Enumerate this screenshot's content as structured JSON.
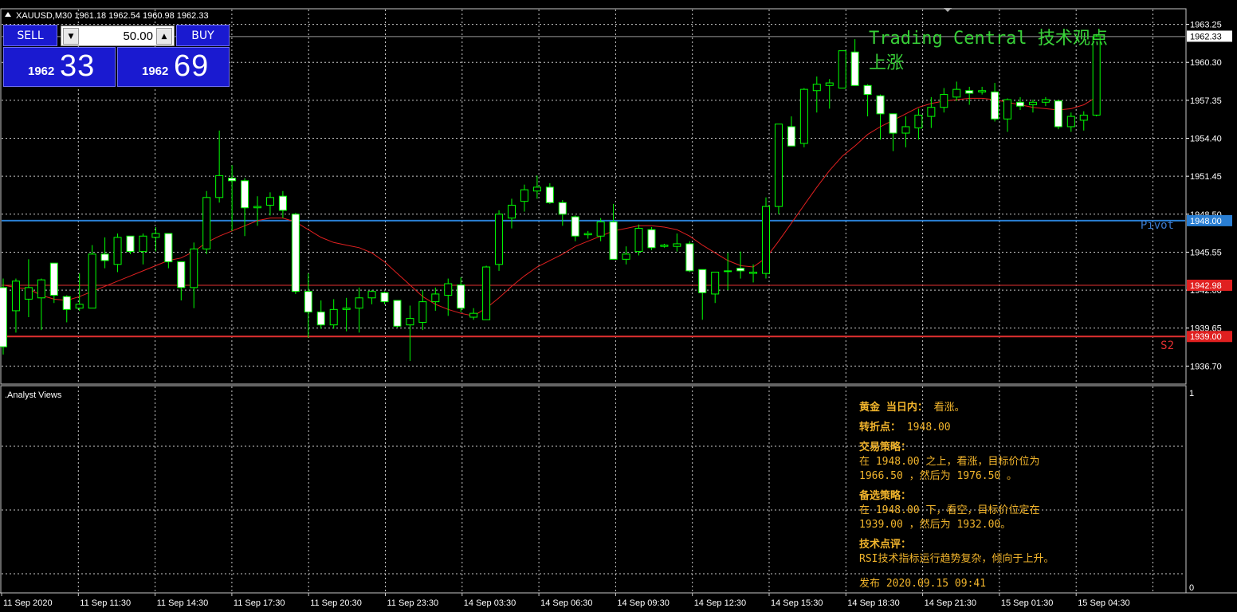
{
  "window": {
    "title": "XAUUSD,M30  1961.18 1962.54 1960.98 1962.33"
  },
  "one_click": {
    "sell_label": "SELL",
    "buy_label": "BUY",
    "volume": "50.00",
    "bid_prefix": "1962",
    "bid_big": "33",
    "ask_prefix": "1962",
    "ask_big": "69"
  },
  "overlay": {
    "title": "Trading Central 技术观点",
    "signal": "上涨"
  },
  "levels": {
    "pivot_label": "Pivot",
    "s2_label": "S2"
  },
  "price_axis": {
    "ticks": [
      "1963.25",
      "1960.30",
      "1957.35",
      "1954.40",
      "1951.45",
      "1948.50",
      "1945.55",
      "1942.60",
      "1939.65",
      "1936.70"
    ],
    "tags": {
      "current": "1962.33",
      "pivot": "1948.00",
      "level_mid": "1942.98",
      "s2": "1939.00"
    }
  },
  "time_axis": {
    "labels": [
      "11 Sep 2020",
      "11 Sep 11:30",
      "11 Sep 14:30",
      "11 Sep 17:30",
      "11 Sep 20:30",
      "11 Sep 23:30",
      "14 Sep 03:30",
      "14 Sep 06:30",
      "14 Sep 09:30",
      "14 Sep 12:30",
      "14 Sep 15:30",
      "14 Sep 18:30",
      "14 Sep 21:30",
      "15 Sep 01:30",
      "15 Sep 04:30"
    ]
  },
  "indicator": {
    "name": ".Analyst Views",
    "scale_top": "1",
    "scale_bottom": "0"
  },
  "analyst": {
    "line1_head": "黄金 当日内：",
    "line1_val": "看涨。",
    "pivot_head": "转折点：",
    "pivot_val": "1948.00",
    "strategy_head": "交易策略：",
    "strategy_line1": "在 1948.00 之上，看涨，目标价位为",
    "strategy_line2": "1966.50 ，然后为 1976.50 。",
    "alt_head": "备选策略：",
    "alt_line1": "在 1948.00 下，看空，目标价位定在",
    "alt_line2": "1939.00 ，然后为 1932.00。",
    "comment_head": "技术点评：",
    "comment_line": "RSI技术指标运行趋势复杂，倾向于上升。",
    "published": "发布 2020.09.15 09:41"
  },
  "colors": {
    "background": "#000000",
    "grid": "#c8c8c8",
    "bull_candle": "#00ff00",
    "bear_candle": "#ffffff",
    "ma_line": "#e02020",
    "pivot_line": "#2a7fd4",
    "level_line": "#e03030",
    "overlay_text": "#38d038",
    "analyst_text": "#f2b52c",
    "button_blue": "#1a1ad0"
  },
  "chart_data": {
    "type": "candlestick",
    "symbol": "XAUUSD",
    "timeframe": "M30",
    "y_range": [
      1935.3,
      1964.4
    ],
    "horizontal_levels": [
      {
        "label": "Pivot",
        "value": 1948.0
      },
      {
        "label": "",
        "value": 1942.98
      },
      {
        "label": "S2",
        "value": 1939.0
      }
    ],
    "candles": [
      [
        1942.8,
        1943.5,
        1937.6,
        1938.2
      ],
      [
        1941.0,
        1943.5,
        1939.3,
        1943.3
      ],
      [
        1941.9,
        1945.0,
        1940.5,
        1942.8
      ],
      [
        1942.0,
        1943.5,
        1939.5,
        1943.4
      ],
      [
        1944.7,
        1944.7,
        1941.6,
        1942.2
      ],
      [
        1942.1,
        1942.2,
        1940.1,
        1941.1
      ],
      [
        1941.2,
        1943.9,
        1941.0,
        1941.5
      ],
      [
        1941.2,
        1946.1,
        1941.2,
        1945.4
      ],
      [
        1945.4,
        1946.7,
        1944.3,
        1944.9
      ],
      [
        1944.6,
        1947.0,
        1944.0,
        1946.7
      ],
      [
        1946.8,
        1946.8,
        1945.4,
        1945.6
      ],
      [
        1945.6,
        1947.0,
        1944.6,
        1946.8
      ],
      [
        1946.7,
        1947.5,
        1945.6,
        1947.0
      ],
      [
        1947.0,
        1947.0,
        1944.3,
        1944.8
      ],
      [
        1944.8,
        1944.8,
        1941.8,
        1942.8
      ],
      [
        1942.8,
        1946.3,
        1941.2,
        1945.8
      ],
      [
        1945.8,
        1950.3,
        1945.4,
        1949.8
      ],
      [
        1949.8,
        1955.0,
        1949.4,
        1951.5
      ],
      [
        1951.3,
        1952.3,
        1947.2,
        1951.1
      ],
      [
        1951.1,
        1951.3,
        1946.8,
        1949.0
      ],
      [
        1949.0,
        1949.9,
        1947.6,
        1949.1
      ],
      [
        1949.2,
        1950.2,
        1948.4,
        1949.8
      ],
      [
        1949.9,
        1950.3,
        1948.2,
        1948.8
      ],
      [
        1948.5,
        1948.6,
        1942.3,
        1942.5
      ],
      [
        1942.5,
        1943.9,
        1938.9,
        1940.9
      ],
      [
        1940.9,
        1941.8,
        1939.6,
        1939.9
      ],
      [
        1939.9,
        1941.9,
        1939.6,
        1941.1
      ],
      [
        1941.1,
        1942.0,
        1939.4,
        1941.2
      ],
      [
        1941.2,
        1942.8,
        1939.3,
        1942.0
      ],
      [
        1942.0,
        1942.6,
        1941.5,
        1942.5
      ],
      [
        1942.4,
        1942.5,
        1941.5,
        1941.7
      ],
      [
        1941.8,
        1941.8,
        1939.7,
        1939.8
      ],
      [
        1939.9,
        1941.4,
        1937.1,
        1940.4
      ],
      [
        1940.1,
        1942.6,
        1939.5,
        1941.7
      ],
      [
        1941.7,
        1942.8,
        1941.0,
        1942.3
      ],
      [
        1942.2,
        1943.5,
        1940.6,
        1943.1
      ],
      [
        1943.0,
        1943.6,
        1940.9,
        1941.2
      ],
      [
        1940.5,
        1941.2,
        1940.3,
        1940.8
      ],
      [
        1940.3,
        1944.5,
        1940.3,
        1944.4
      ],
      [
        1944.6,
        1948.8,
        1944.1,
        1948.5
      ],
      [
        1948.2,
        1949.7,
        1947.4,
        1949.2
      ],
      [
        1949.5,
        1950.8,
        1948.7,
        1950.4
      ],
      [
        1950.3,
        1951.5,
        1949.7,
        1950.6
      ],
      [
        1950.6,
        1950.9,
        1949.3,
        1949.4
      ],
      [
        1949.4,
        1949.6,
        1947.6,
        1948.5
      ],
      [
        1948.3,
        1948.4,
        1946.4,
        1946.8
      ],
      [
        1946.9,
        1947.2,
        1946.6,
        1947.0
      ],
      [
        1946.8,
        1948.2,
        1946.4,
        1947.9
      ],
      [
        1947.9,
        1949.3,
        1945.7,
        1945.0
      ],
      [
        1945.0,
        1946.0,
        1944.6,
        1945.4
      ],
      [
        1945.6,
        1947.7,
        1945.3,
        1947.4
      ],
      [
        1947.3,
        1947.5,
        1945.7,
        1945.9
      ],
      [
        1946.0,
        1946.2,
        1945.9,
        1946.1
      ],
      [
        1946.0,
        1947.0,
        1945.6,
        1946.2
      ],
      [
        1946.2,
        1946.4,
        1944.0,
        1944.1
      ],
      [
        1944.2,
        1944.2,
        1940.3,
        1942.4
      ],
      [
        1942.3,
        1944.0,
        1941.6,
        1944.0
      ],
      [
        1944.1,
        1945.5,
        1942.6,
        1944.1
      ],
      [
        1944.3,
        1945.6,
        1943.5,
        1944.1
      ],
      [
        1943.9,
        1944.6,
        1943.2,
        1944.0
      ],
      [
        1943.9,
        1949.8,
        1943.5,
        1949.1
      ],
      [
        1949.1,
        1954.9,
        1948.5,
        1955.5
      ],
      [
        1955.3,
        1956.1,
        1953.8,
        1953.8
      ],
      [
        1954.0,
        1958.3,
        1953.7,
        1958.2
      ],
      [
        1958.1,
        1959.2,
        1956.4,
        1958.6
      ],
      [
        1958.5,
        1959.0,
        1956.7,
        1958.7
      ],
      [
        1958.3,
        1961.2,
        1958.4,
        1961.2
      ],
      [
        1961.1,
        1962.1,
        1958.6,
        1958.5
      ],
      [
        1958.5,
        1958.6,
        1956.1,
        1957.8
      ],
      [
        1957.7,
        1957.8,
        1954.3,
        1956.3
      ],
      [
        1956.3,
        1956.3,
        1953.4,
        1954.8
      ],
      [
        1954.8,
        1956.1,
        1953.7,
        1955.3
      ],
      [
        1955.2,
        1956.7,
        1954.3,
        1956.2
      ],
      [
        1956.1,
        1957.6,
        1955.2,
        1956.8
      ],
      [
        1956.8,
        1958.3,
        1956.4,
        1957.8
      ],
      [
        1957.6,
        1958.8,
        1957.3,
        1958.2
      ],
      [
        1958.1,
        1958.4,
        1957.0,
        1957.9
      ],
      [
        1958.0,
        1958.4,
        1957.8,
        1958.1
      ],
      [
        1958.0,
        1958.7,
        1955.7,
        1955.9
      ],
      [
        1955.9,
        1957.5,
        1954.9,
        1957.4
      ],
      [
        1957.2,
        1957.6,
        1956.6,
        1956.9
      ],
      [
        1957.0,
        1957.4,
        1956.4,
        1957.2
      ],
      [
        1957.2,
        1957.6,
        1956.9,
        1957.4
      ],
      [
        1957.3,
        1957.4,
        1955.1,
        1955.3
      ],
      [
        1955.3,
        1956.4,
        1954.9,
        1956.1
      ],
      [
        1955.8,
        1956.5,
        1955.0,
        1956.2
      ],
      [
        1956.2,
        1962.5,
        1956.1,
        1962.3
      ]
    ],
    "moving_average": [
      1943.0,
      1942.8,
      1942.7,
      1942.2,
      1941.9,
      1941.8,
      1942.1,
      1942.5,
      1942.9,
      1943.3,
      1943.7,
      1944.1,
      1944.5,
      1944.9,
      1945.1,
      1945.6,
      1946.3,
      1946.8,
      1947.2,
      1947.6,
      1948.0,
      1948.2,
      1948.2,
      1947.9,
      1947.3,
      1946.7,
      1946.3,
      1946.1,
      1945.9,
      1945.5,
      1944.8,
      1943.9,
      1943.0,
      1942.1,
      1941.5,
      1941.1,
      1940.8,
      1940.6,
      1941.2,
      1942.0,
      1942.9,
      1943.7,
      1944.4,
      1944.9,
      1945.4,
      1946.0,
      1946.4,
      1946.8,
      1947.2,
      1947.4,
      1947.6,
      1947.6,
      1947.5,
      1947.3,
      1946.8,
      1946.1,
      1945.5,
      1944.9,
      1944.5,
      1944.4,
      1945.1,
      1946.4,
      1947.8,
      1949.2,
      1950.6,
      1951.9,
      1953.0,
      1953.8,
      1954.7,
      1955.3,
      1955.8,
      1956.3,
      1956.8,
      1957.1,
      1957.3,
      1957.4,
      1957.5,
      1957.5,
      1957.4,
      1957.2,
      1957.0,
      1956.8,
      1956.7,
      1956.6,
      1956.7,
      1957.0,
      1957.6
    ]
  }
}
